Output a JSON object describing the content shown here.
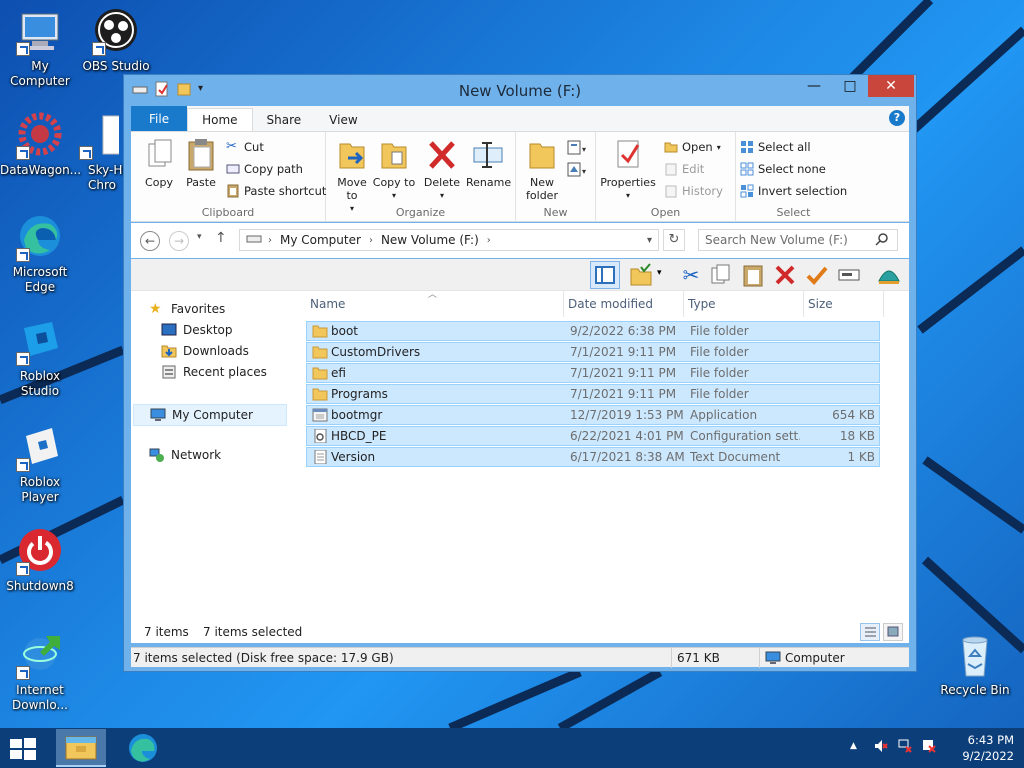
{
  "desktop": {
    "icons": [
      {
        "label": "My Computer",
        "icon": "computer-icon"
      },
      {
        "label": "OBS Studio",
        "icon": "obs-icon"
      },
      {
        "label": "DataWagon...",
        "icon": "gear-icon"
      },
      {
        "label": "Sky-Hi Chro",
        "icon": "document-icon"
      },
      {
        "label": "Microsoft Edge",
        "icon": "edge-icon"
      },
      {
        "label": "Roblox Studio",
        "icon": "roblox-studio-icon"
      },
      {
        "label": "Roblox Player",
        "icon": "roblox-icon"
      },
      {
        "label": "Shutdown8",
        "icon": "power-icon"
      },
      {
        "label": "Internet Downlo...",
        "icon": "download-icon"
      },
      {
        "label": "Recycle Bin",
        "icon": "recycle-bin-icon"
      }
    ]
  },
  "window": {
    "title": "New Volume (F:)",
    "tabs": [
      "File",
      "Home",
      "Share",
      "View"
    ],
    "help": "?"
  },
  "ribbon": {
    "clipboard": {
      "label": "Clipboard",
      "copy": "Copy",
      "paste": "Paste",
      "cut": "Cut",
      "copy_path": "Copy path",
      "paste_shortcut": "Paste shortcut"
    },
    "organize": {
      "label": "Organize",
      "move_to": "Move to",
      "copy_to": "Copy to",
      "delete": "Delete",
      "rename": "Rename"
    },
    "new": {
      "label": "New",
      "new_folder": "New folder"
    },
    "open": {
      "label": "Open",
      "properties": "Properties",
      "open": "Open",
      "edit": "Edit",
      "history": "History"
    },
    "select": {
      "label": "Select",
      "select_all": "Select all",
      "select_none": "Select none",
      "invert_selection": "Invert selection"
    }
  },
  "address": {
    "crumbs": [
      "My Computer",
      "New Volume (F:)"
    ],
    "search_placeholder": "Search New Volume (F:)"
  },
  "navpane": {
    "favorites": "Favorites",
    "desktop": "Desktop",
    "downloads": "Downloads",
    "recent": "Recent places",
    "computer": "My Computer",
    "network": "Network"
  },
  "columns": {
    "name": "Name",
    "date": "Date modified",
    "type": "Type",
    "size": "Size"
  },
  "files": [
    {
      "name": "boot",
      "date": "9/2/2022 6:38 PM",
      "type": "File folder",
      "size": "",
      "icon": "folder-icon"
    },
    {
      "name": "CustomDrivers",
      "date": "7/1/2021 9:11 PM",
      "type": "File folder",
      "size": "",
      "icon": "folder-icon"
    },
    {
      "name": "efi",
      "date": "7/1/2021 9:11 PM",
      "type": "File folder",
      "size": "",
      "icon": "folder-icon"
    },
    {
      "name": "Programs",
      "date": "7/1/2021 9:11 PM",
      "type": "File folder",
      "size": "",
      "icon": "folder-icon"
    },
    {
      "name": "bootmgr",
      "date": "12/7/2019 1:53 PM",
      "type": "Application",
      "size": "654 KB",
      "icon": "application-icon"
    },
    {
      "name": "HBCD_PE",
      "date": "6/22/2021 4:01 PM",
      "type": "Configuration sett...",
      "size": "18 KB",
      "icon": "config-file-icon"
    },
    {
      "name": "Version",
      "date": "6/17/2021 8:38 AM",
      "type": "Text Document",
      "size": "1 KB",
      "icon": "text-file-icon"
    }
  ],
  "status": {
    "items": "7 items",
    "selected": "7 items selected",
    "details": "7 items selected (Disk free space: 17.9 GB)",
    "size": "671 KB",
    "location": "Computer"
  },
  "taskbar": {
    "time": "6:43 PM",
    "date": "9/2/2022"
  }
}
